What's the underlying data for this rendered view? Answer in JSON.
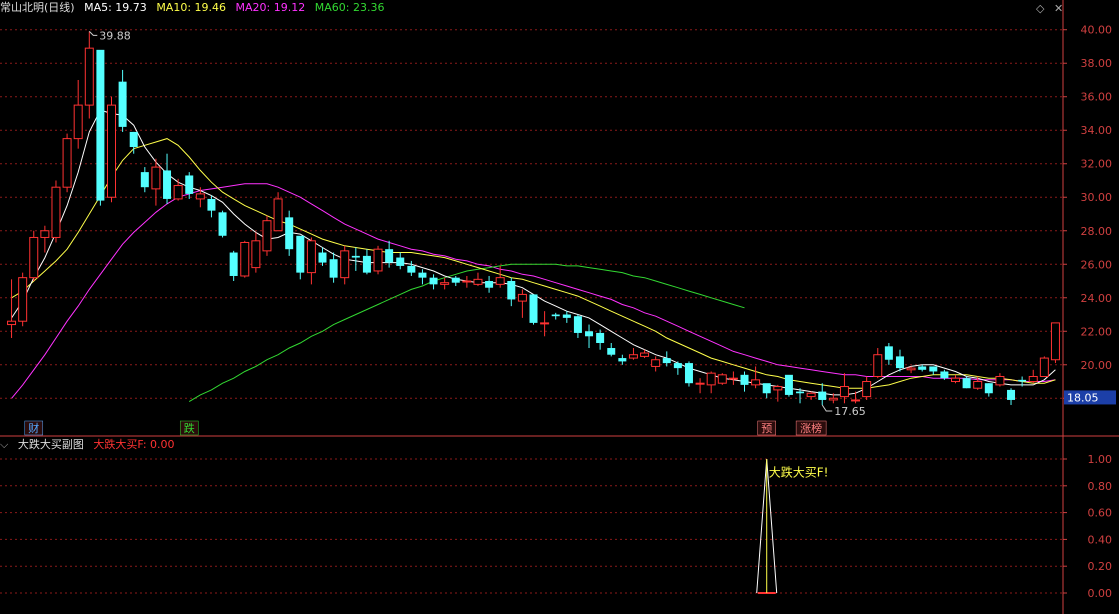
{
  "main_header": {
    "title": "常山北明(日线)",
    "ma5": "MA5: 19.73",
    "ma10": "MA10: 19.46",
    "ma20": "MA20: 19.12",
    "ma60": "MA60: 23.36"
  },
  "sub_header": {
    "icon": "chevron-down-icon",
    "title": "大跌大买副图",
    "value": "大跌大买F: 0.00"
  },
  "colors": {
    "up": "#ff3232",
    "down": "#54ffff",
    "ma5": "#ffffff",
    "ma10": "#ffff4a",
    "ma20": "#ff32ff",
    "ma60": "#32d832",
    "grid": "#8b1a1a",
    "axis": "#d04040",
    "price_label_bg": "#1c3fa8"
  },
  "chart_data": [
    {
      "type": "candlestick",
      "y_ticks": [
        "40.00",
        "38.00",
        "36.00",
        "34.00",
        "32.00",
        "30.00",
        "28.00",
        "26.00",
        "24.00",
        "22.00",
        "20.00",
        "18.00"
      ],
      "ylim": [
        17.3,
        40.7
      ],
      "current_price": "18.05",
      "high_label": "39.88",
      "low_label": "17.65",
      "badges": [
        {
          "text": "财",
          "color": "#54a8ff",
          "index": 2
        },
        {
          "text": "跌",
          "color": "#32d832",
          "index": 16
        },
        {
          "text": "预",
          "color": "#ff8080",
          "index": 68
        },
        {
          "text": "涨榜",
          "color": "#ff8080",
          "index": 72
        }
      ],
      "candles": [
        [
          22.4,
          22.6,
          21.6,
          25.1
        ],
        [
          22.6,
          25.2,
          22.3,
          25.5
        ],
        [
          25.2,
          27.6,
          25.0,
          28.0
        ],
        [
          27.6,
          28.0,
          26.7,
          28.3
        ],
        [
          27.6,
          30.6,
          27.3,
          31.0
        ],
        [
          30.6,
          33.5,
          30.3,
          33.8
        ],
        [
          33.5,
          35.5,
          32.9,
          37.0
        ],
        [
          35.5,
          38.9,
          34.7,
          39.9
        ],
        [
          38.8,
          29.8,
          29.5,
          38.4
        ],
        [
          30.0,
          35.5,
          29.7,
          36.0
        ],
        [
          36.9,
          34.2,
          33.9,
          37.6
        ],
        [
          33.9,
          33.0,
          32.6,
          33.9
        ],
        [
          31.5,
          30.6,
          30.3,
          31.8
        ],
        [
          30.5,
          31.8,
          29.5,
          32.3
        ],
        [
          31.6,
          29.9,
          29.6,
          32.6
        ],
        [
          29.9,
          30.7,
          29.8,
          31.1
        ],
        [
          31.3,
          30.2,
          29.9,
          31.5
        ],
        [
          29.9,
          30.2,
          29.4,
          30.6
        ],
        [
          29.9,
          29.2,
          28.8,
          30.1
        ],
        [
          29.1,
          27.7,
          27.6,
          29.2
        ],
        [
          26.7,
          25.3,
          25.0,
          26.8
        ],
        [
          25.3,
          27.3,
          25.2,
          27.4
        ],
        [
          25.8,
          27.4,
          25.5,
          27.9
        ],
        [
          26.8,
          28.6,
          26.5,
          28.9
        ],
        [
          28.0,
          29.9,
          28.6,
          30.3
        ],
        [
          28.8,
          26.9,
          26.5,
          29.2
        ],
        [
          27.7,
          25.5,
          25.1,
          27.6
        ],
        [
          25.5,
          27.4,
          24.8,
          27.6
        ],
        [
          26.7,
          26.1,
          25.9,
          27.0
        ],
        [
          26.3,
          25.2,
          24.9,
          26.7
        ],
        [
          25.2,
          26.8,
          24.8,
          27.1
        ],
        [
          26.5,
          26.4,
          25.6,
          27.0
        ],
        [
          26.5,
          25.5,
          25.4,
          26.9
        ],
        [
          25.6,
          26.9,
          25.4,
          27.1
        ],
        [
          26.9,
          26.1,
          25.8,
          27.4
        ],
        [
          26.4,
          25.9,
          25.7,
          26.7
        ],
        [
          25.9,
          25.5,
          25.3,
          26.2
        ],
        [
          25.5,
          25.2,
          24.8,
          25.7
        ],
        [
          25.2,
          24.8,
          24.5,
          25.4
        ],
        [
          24.8,
          24.9,
          24.5,
          25.2
        ],
        [
          25.2,
          24.9,
          24.7,
          25.3
        ],
        [
          25.0,
          25.0,
          24.6,
          25.3
        ],
        [
          24.8,
          25.1,
          24.7,
          25.5
        ],
        [
          25.0,
          24.6,
          24.3,
          25.3
        ],
        [
          24.8,
          25.2,
          24.6,
          25.9
        ],
        [
          25.0,
          23.9,
          23.5,
          25.2
        ],
        [
          23.8,
          24.2,
          22.8,
          24.5
        ],
        [
          24.2,
          22.5,
          22.4,
          24.2
        ],
        [
          22.5,
          22.5,
          21.7,
          23.2
        ],
        [
          23.0,
          22.9,
          22.7,
          23.1
        ],
        [
          23.0,
          22.8,
          22.5,
          23.2
        ],
        [
          22.9,
          21.9,
          21.6,
          23.0
        ],
        [
          22.0,
          21.7,
          21.0,
          22.4
        ],
        [
          21.9,
          21.3,
          20.9,
          22.1
        ],
        [
          21.0,
          20.6,
          20.5,
          21.3
        ],
        [
          20.4,
          20.2,
          20.0,
          20.6
        ],
        [
          20.4,
          20.6,
          20.3,
          21.0
        ],
        [
          20.5,
          20.7,
          20.4,
          20.9
        ],
        [
          19.9,
          20.3,
          19.6,
          20.5
        ],
        [
          20.4,
          20.1,
          19.9,
          20.8
        ],
        [
          20.1,
          19.8,
          19.4,
          20.2
        ],
        [
          20.1,
          18.9,
          18.7,
          20.2
        ],
        [
          18.9,
          18.9,
          18.3,
          19.2
        ],
        [
          18.8,
          19.5,
          18.3,
          19.6
        ],
        [
          18.9,
          19.4,
          18.8,
          19.5
        ],
        [
          19.2,
          19.2,
          18.8,
          19.6
        ],
        [
          19.4,
          18.8,
          18.4,
          19.6
        ],
        [
          18.8,
          19.1,
          18.6,
          19.9
        ],
        [
          18.9,
          18.3,
          18.0,
          18.5
        ],
        [
          18.5,
          18.7,
          17.8,
          18.8
        ],
        [
          19.4,
          18.2,
          18.1,
          19.1
        ],
        [
          18.4,
          18.3,
          17.7,
          18.6
        ],
        [
          18.1,
          18.3,
          17.9,
          18.4
        ],
        [
          18.4,
          17.9,
          17.6,
          18.9
        ],
        [
          17.9,
          18.0,
          17.7,
          18.3
        ],
        [
          18.1,
          18.7,
          17.7,
          19.5
        ],
        [
          17.9,
          17.9,
          17.7,
          18.4
        ],
        [
          18.1,
          19.0,
          17.9,
          19.3
        ],
        [
          19.3,
          20.6,
          19.2,
          21.0
        ],
        [
          21.1,
          20.3,
          20.0,
          21.3
        ],
        [
          20.5,
          19.8,
          19.6,
          20.9
        ],
        [
          19.7,
          19.8,
          19.5,
          19.9
        ],
        [
          19.9,
          19.7,
          19.6,
          20.0
        ],
        [
          19.9,
          19.6,
          19.4,
          19.9
        ],
        [
          19.6,
          19.2,
          19.1,
          19.7
        ],
        [
          19.0,
          19.2,
          18.9,
          19.4
        ],
        [
          19.2,
          18.6,
          18.6,
          19.3
        ],
        [
          18.6,
          19.0,
          18.5,
          19.3
        ],
        [
          18.9,
          18.3,
          18.1,
          18.9
        ],
        [
          18.8,
          19.3,
          18.7,
          19.5
        ],
        [
          18.5,
          17.9,
          17.6,
          18.6
        ],
        [
          19.1,
          19.0,
          18.7,
          19.3
        ],
        [
          19.0,
          19.3,
          18.9,
          19.7
        ],
        [
          19.3,
          20.4,
          19.3,
          20.5
        ],
        [
          20.3,
          22.5,
          20.1,
          22.5
        ]
      ],
      "ma5": [
        22.8,
        23.8,
        25.2,
        26.4,
        27.9,
        29.5,
        31.5,
        33.9,
        35.2,
        35.0,
        34.9,
        34.3,
        33.0,
        32.1,
        31.4,
        30.9,
        30.6,
        30.4,
        30.1,
        29.7,
        29.0,
        28.4,
        27.9,
        27.5,
        27.6,
        27.9,
        27.8,
        27.4,
        27.0,
        26.6,
        26.3,
        26.2,
        26.1,
        26.1,
        26.1,
        26.1,
        26.0,
        25.8,
        25.6,
        25.3,
        25.1,
        25.0,
        24.9,
        24.9,
        24.9,
        24.8,
        24.6,
        24.2,
        23.8,
        23.5,
        23.2,
        23.0,
        22.8,
        22.4,
        22.0,
        21.6,
        21.2,
        20.9,
        20.6,
        20.4,
        20.1,
        19.8,
        19.6,
        19.4,
        19.2,
        19.1,
        19.0,
        18.9,
        18.8,
        18.7,
        18.6,
        18.5,
        18.4,
        18.3,
        18.2,
        18.2,
        18.3,
        18.6,
        19.0,
        19.4,
        19.7,
        19.9,
        20.0,
        20.0,
        19.8,
        19.6,
        19.3,
        19.2,
        19.0,
        18.9,
        18.8,
        18.8,
        18.8,
        19.1,
        19.7
      ],
      "ma10": [
        24.0,
        24.4,
        25.0,
        25.6,
        26.2,
        26.9,
        27.9,
        29.0,
        30.1,
        31.2,
        32.2,
        32.9,
        33.1,
        33.3,
        33.5,
        33.1,
        32.4,
        31.6,
        30.9,
        30.3,
        29.9,
        29.5,
        29.2,
        28.9,
        28.6,
        28.4,
        28.1,
        27.8,
        27.5,
        27.3,
        27.1,
        27.0,
        26.9,
        26.8,
        26.7,
        26.7,
        26.7,
        26.6,
        26.5,
        26.4,
        26.2,
        26.0,
        25.8,
        25.6,
        25.4,
        25.2,
        25.1,
        24.9,
        24.7,
        24.5,
        24.3,
        24.1,
        23.8,
        23.5,
        23.2,
        22.9,
        22.6,
        22.3,
        22.0,
        21.6,
        21.3,
        21.0,
        20.7,
        20.4,
        20.2,
        20.0,
        19.8,
        19.6,
        19.4,
        19.3,
        19.1,
        19.0,
        18.9,
        18.8,
        18.7,
        18.6,
        18.6,
        18.6,
        18.7,
        18.8,
        19.0,
        19.2,
        19.3,
        19.4,
        19.4,
        19.4,
        19.4,
        19.3,
        19.2,
        19.2,
        19.1,
        19.0,
        18.9,
        18.9,
        19.1
      ],
      "ma20": [
        18.0,
        18.8,
        19.7,
        20.6,
        21.6,
        22.6,
        23.5,
        24.5,
        25.4,
        26.3,
        27.2,
        27.9,
        28.5,
        29.1,
        29.6,
        30.0,
        30.2,
        30.4,
        30.5,
        30.6,
        30.7,
        30.8,
        30.8,
        30.8,
        30.6,
        30.3,
        30.0,
        29.6,
        29.2,
        28.8,
        28.4,
        28.1,
        27.8,
        27.5,
        27.3,
        27.1,
        26.9,
        26.8,
        26.6,
        26.5,
        26.3,
        26.2,
        26.0,
        25.9,
        25.7,
        25.6,
        25.4,
        25.3,
        25.1,
        24.9,
        24.7,
        24.5,
        24.3,
        24.1,
        23.9,
        23.6,
        23.4,
        23.1,
        22.9,
        22.6,
        22.3,
        22.0,
        21.7,
        21.4,
        21.1,
        20.8,
        20.6,
        20.4,
        20.2,
        20.0,
        19.9,
        19.8,
        19.7,
        19.6,
        19.5,
        19.4,
        19.4,
        19.3,
        19.3,
        19.3,
        19.3,
        19.3,
        19.3,
        19.2,
        19.2,
        19.2,
        19.2,
        19.1,
        19.1,
        19.1,
        19.1,
        19.0,
        19.0,
        19.0,
        19.1
      ],
      "ma60_start_index": 16,
      "ma60": [
        17.8,
        18.2,
        18.5,
        18.9,
        19.2,
        19.6,
        19.9,
        20.3,
        20.6,
        21.0,
        21.3,
        21.7,
        22.0,
        22.4,
        22.7,
        23.0,
        23.3,
        23.6,
        23.9,
        24.2,
        24.5,
        24.7,
        25.0,
        25.2,
        25.4,
        25.6,
        25.7,
        25.8,
        25.9,
        26.0,
        26.0,
        26.0,
        26.0,
        26.0,
        25.9,
        25.9,
        25.8,
        25.7,
        25.6,
        25.5,
        25.3,
        25.2,
        25.0,
        24.8,
        24.6,
        24.4,
        24.2,
        24.0,
        23.8,
        23.6,
        23.4
      ]
    },
    {
      "type": "line",
      "y_ticks": [
        "1.00",
        "0.80",
        "0.60",
        "0.40",
        "0.20",
        "0.00"
      ],
      "ylim": [
        0,
        1.0
      ],
      "annotation": "大跌大买F!",
      "spike_index": 68,
      "values_note": "0 except spike_index = 1"
    }
  ]
}
